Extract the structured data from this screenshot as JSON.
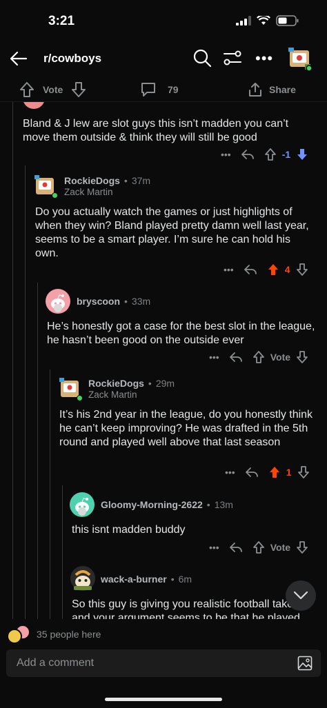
{
  "status": {
    "time": "3:21"
  },
  "header": {
    "subreddit": "r/cowboys"
  },
  "post_actions": {
    "vote_label": "Vote",
    "comment_count": "79",
    "share_label": "Share"
  },
  "comments": [
    {
      "text": "Bland & J lew are slot guys this isn’t madden you can’t move them outside & think they will still be good",
      "vote": "-1"
    },
    {
      "user": "RockieDogs",
      "time": "37m",
      "flair": "Zack Martin",
      "text": "Do you actually watch the games or just highlights of when they win? Bland played pretty damn well last year, seems to be a smart player. I’m sure he can hold his own.",
      "vote": "4"
    },
    {
      "user": "bryscoon",
      "time": "33m",
      "text": "He’s honestly got a case for the best slot in the league, he hasn’t been good on the outside ever",
      "vote": "Vote"
    },
    {
      "user": "RockieDogs",
      "time": "29m",
      "flair": "Zack Martin",
      "text": "It’s his 2nd year in the league, do you honestly think he can’t keep improving? He was drafted in the 5th round and played well above that last season",
      "vote": "1"
    },
    {
      "user": "Gloomy-Morning-2622",
      "time": "13m",
      "text": "this isnt madden buddy",
      "vote": "Vote"
    },
    {
      "user": "wack-a-burner",
      "time": "6m",
      "text": "So this guy is giving you realistic football takes and your argument seems to be that he played"
    }
  ],
  "presence": {
    "text": "35 people here"
  },
  "composer": {
    "placeholder": "Add a comment"
  },
  "colors": {
    "upvote": "#ff4500",
    "downvote": "#7193ff",
    "background": "#0b0b0b"
  }
}
